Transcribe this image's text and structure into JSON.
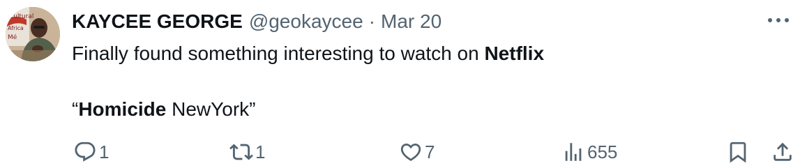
{
  "tweet": {
    "author_name": "KAYCEE GEORGE",
    "handle": "@geokaycee",
    "separator": "·",
    "date": "Mar 20",
    "text_line1_prefix": "Finally found something interesting to watch on ",
    "text_line1_bold": "Netflix",
    "text_line2_open_quote": "“",
    "text_line2_bold": "Homicide",
    "text_line2_rest": " NewYork”"
  },
  "avatar": {
    "sign_text_1": "Cultural",
    "sign_text_2": "Africa",
    "sign_text_3": "Mé"
  },
  "actions": {
    "replies": "1",
    "reposts": "1",
    "likes": "7",
    "views": "655"
  },
  "icons": {
    "more": "more-horizontal-icon",
    "reply": "reply-icon",
    "repost": "repost-icon",
    "like": "heart-icon",
    "views": "views-icon",
    "bookmark": "bookmark-icon",
    "share": "share-icon"
  },
  "colors": {
    "text": "#0f1419",
    "secondary": "#536471"
  }
}
